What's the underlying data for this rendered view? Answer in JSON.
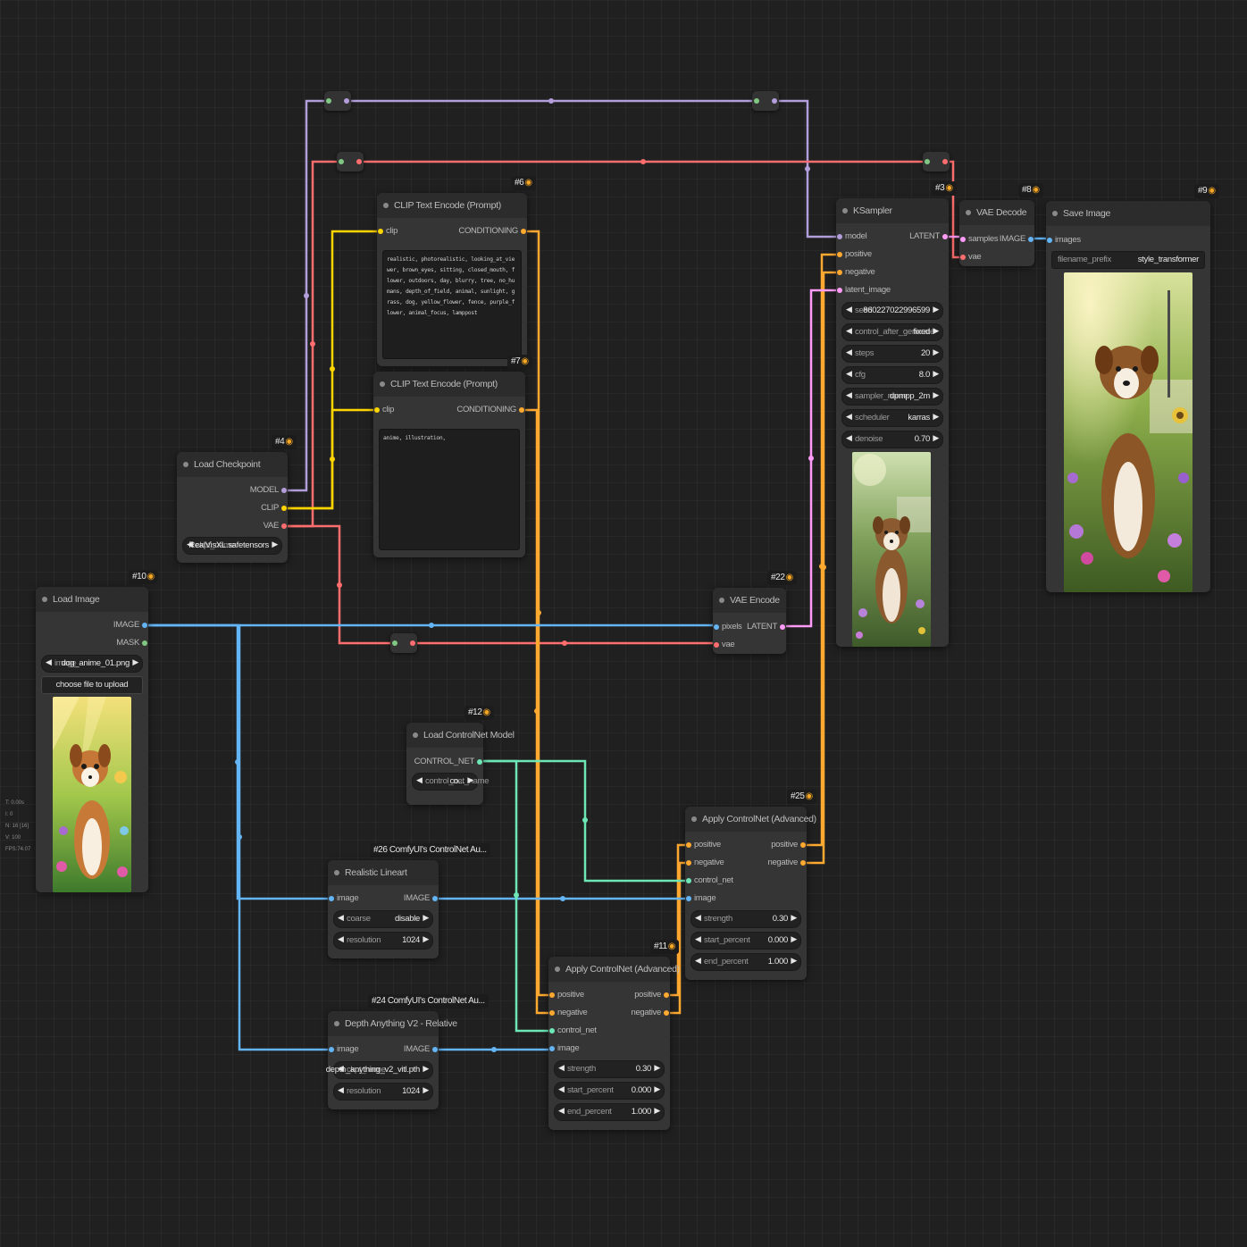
{
  "colors": {
    "model": "#b39ddb",
    "clip": "#ffd500",
    "vae": "#ff6e6e",
    "conditioning": "#ffa931",
    "latent": "#ff9cf9",
    "image": "#64b5f6",
    "mask": "#81c784",
    "control_net": "#6ee7b7"
  },
  "stats": [
    "T: 0.00s",
    "I: 0",
    "N: 16 [16]",
    "V: 100",
    "FPS:74.07"
  ],
  "nodes": {
    "load_checkpoint": {
      "badge": "#4",
      "title": "Load Checkpoint",
      "outputs": [
        "MODEL",
        "CLIP",
        "VAE"
      ],
      "widgets": [
        {
          "name": "ckpt_name",
          "value": "RealVisXL.safetensors"
        }
      ]
    },
    "clip_pos": {
      "badge": "#6",
      "title": "CLIP Text Encode (Prompt)",
      "input": "clip",
      "output": "CONDITIONING",
      "text": "realistic, photorealistic, looking_at_viewer, brown_eyes, sitting, closed_mouth, flower, outdoors, day, blurry, tree, no_humans, depth_of_field, animal, sunlight, grass, dog, yellow_flower, fence, purple_flower, animal_focus, lamppost"
    },
    "clip_neg": {
      "badge": "#7",
      "title": "CLIP Text Encode (Prompt)",
      "input": "clip",
      "output": "CONDITIONING",
      "text": "anime, illustration,"
    },
    "ksampler": {
      "badge": "#3",
      "title": "KSampler",
      "inputs": [
        "model",
        "positive",
        "negative",
        "latent_image"
      ],
      "output": "LATENT",
      "widgets": [
        {
          "name": "seed",
          "value": "860227022996599"
        },
        {
          "name": "control_after_generate",
          "value": "fixed"
        },
        {
          "name": "steps",
          "value": "20"
        },
        {
          "name": "cfg",
          "value": "8.0"
        },
        {
          "name": "sampler_name",
          "value": "dpmpp_2m"
        },
        {
          "name": "scheduler",
          "value": "karras"
        },
        {
          "name": "denoise",
          "value": "0.70"
        }
      ]
    },
    "vae_decode": {
      "badge": "#8",
      "title": "VAE Decode",
      "inputs": [
        "samples",
        "vae"
      ],
      "output": "IMAGE"
    },
    "save_image": {
      "badge": "#9",
      "title": "Save Image",
      "input": "images",
      "widgets": [
        {
          "name": "filename_prefix",
          "value": "style_transformer"
        }
      ]
    },
    "load_image": {
      "badge": "#10",
      "title": "Load Image",
      "outputs": [
        "IMAGE",
        "MASK"
      ],
      "widgets": [
        {
          "name": "image",
          "value": "dog_anime_01.png"
        }
      ],
      "button": "choose file to upload"
    },
    "vae_encode": {
      "badge": "#22",
      "title": "VAE Encode",
      "inputs": [
        "pixels",
        "vae"
      ],
      "output": "LATENT"
    },
    "load_controlnet": {
      "badge": "#12",
      "title": "Load ControlNet Model",
      "output": "CONTROL_NET",
      "widgets": [
        {
          "name": "control_net_name",
          "value": "co..."
        }
      ]
    },
    "apply_cn_25": {
      "badge": "#25",
      "title": "Apply ControlNet (Advanced)",
      "inputs": [
        "positive",
        "negative",
        "control_net",
        "image"
      ],
      "outputs": [
        "positive",
        "negative"
      ],
      "widgets": [
        {
          "name": "strength",
          "value": "0.30"
        },
        {
          "name": "start_percent",
          "value": "0.000"
        },
        {
          "name": "end_percent",
          "value": "1.000"
        }
      ]
    },
    "apply_cn_11": {
      "badge": "#11",
      "title": "Apply ControlNet (Advanced)",
      "inputs": [
        "positive",
        "negative",
        "control_net",
        "image"
      ],
      "outputs": [
        "positive",
        "negative"
      ],
      "widgets": [
        {
          "name": "strength",
          "value": "0.30"
        },
        {
          "name": "start_percent",
          "value": "0.000"
        },
        {
          "name": "end_percent",
          "value": "1.000"
        }
      ]
    },
    "lineart": {
      "badge": "#26 ComfyUI's ControlNet Au...",
      "title": "Realistic Lineart",
      "input": "image",
      "output": "IMAGE",
      "widgets": [
        {
          "name": "coarse",
          "value": "disable"
        },
        {
          "name": "resolution",
          "value": "1024"
        }
      ]
    },
    "depth": {
      "badge": "#24 ComfyUI's ControlNet Au...",
      "title": "Depth Anything V2 - Relative",
      "input": "image",
      "output": "IMAGE",
      "widgets": [
        {
          "name": "ckpt_name",
          "value": "depth_anything_v2_vitl.pth"
        },
        {
          "name": "resolution",
          "value": "1024"
        }
      ]
    }
  }
}
